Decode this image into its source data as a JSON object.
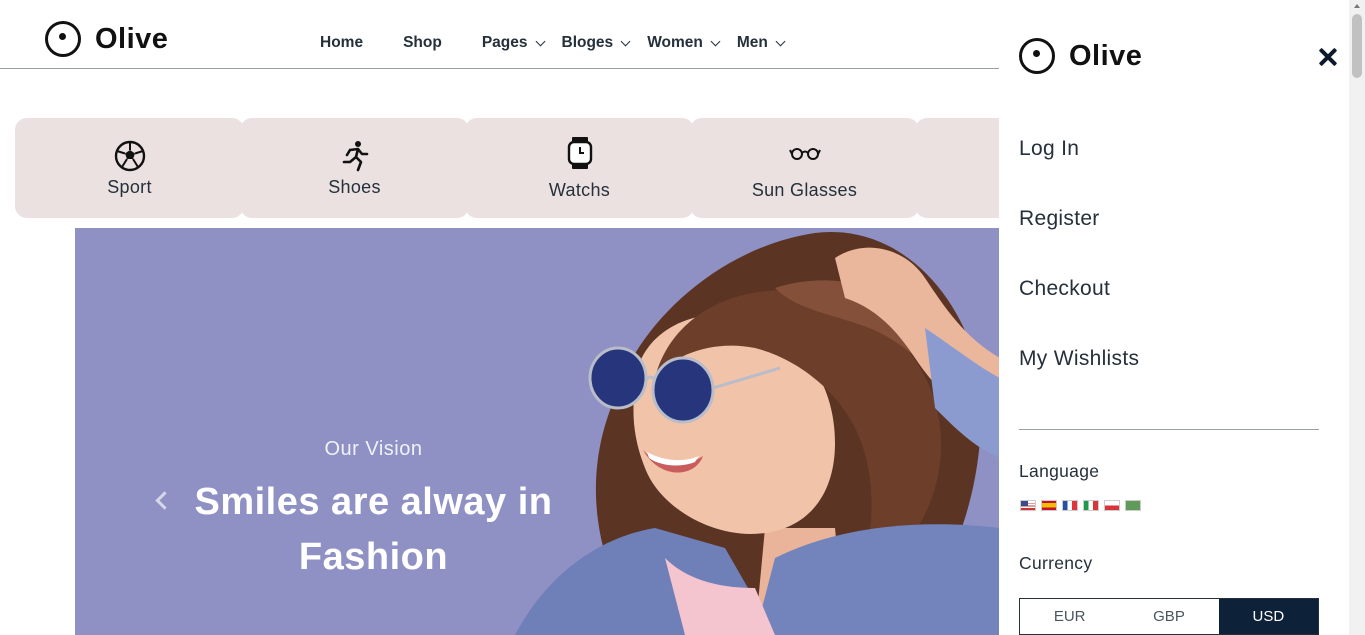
{
  "brand": {
    "name": "Olive"
  },
  "nav": [
    {
      "label": "Home",
      "has_submenu": false
    },
    {
      "label": "Shop",
      "has_submenu": false
    },
    {
      "label": "Pages",
      "has_submenu": true
    },
    {
      "label": "Bloges",
      "has_submenu": true
    },
    {
      "label": "Women",
      "has_submenu": true
    },
    {
      "label": "Men",
      "has_submenu": true
    }
  ],
  "categories": [
    {
      "label": "Sport",
      "icon": "soccer-ball-icon"
    },
    {
      "label": "Shoes",
      "icon": "running-person-icon"
    },
    {
      "label": "Watchs",
      "icon": "watch-icon"
    },
    {
      "label": "Sun Glasses",
      "icon": "glasses-icon"
    }
  ],
  "hero": {
    "subtitle": "Our Vision",
    "title_line1": "Smiles are alway in",
    "title_line2": "Fashion",
    "background": "#8f90c4"
  },
  "sidebar": {
    "brand": "Olive",
    "links": [
      "Log In",
      "Register",
      "Checkout",
      "My Wishlists"
    ],
    "language_heading": "Language",
    "languages": [
      "english-flag-icon",
      "spanish-flag-icon",
      "french-flag-icon",
      "italian-flag-icon",
      "polish-flag-icon",
      "arabic-flag-icon"
    ],
    "currency_heading": "Currency",
    "currencies": [
      "EUR",
      "GBP",
      "USD"
    ],
    "selected_currency": "USD"
  },
  "colors": {
    "category_card": "#ebe1e1",
    "currency_active": "#0d2239",
    "text": "#25303b"
  }
}
